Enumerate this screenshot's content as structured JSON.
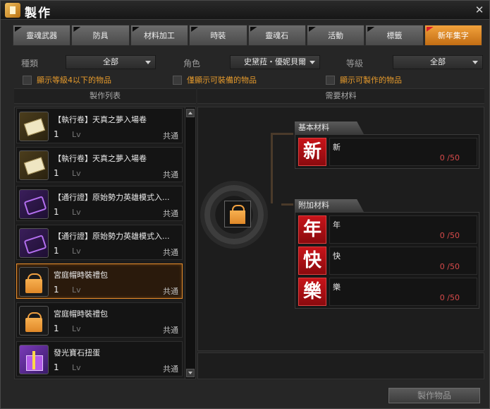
{
  "window": {
    "title": "製作"
  },
  "tabs": [
    {
      "label": "靈魂武器",
      "active": false
    },
    {
      "label": "防具",
      "active": false
    },
    {
      "label": "材料加工",
      "active": false
    },
    {
      "label": "時裝",
      "active": false
    },
    {
      "label": "靈魂石",
      "active": false
    },
    {
      "label": "活動",
      "active": false
    },
    {
      "label": "標籤",
      "active": false
    },
    {
      "label": "新年集字",
      "active": true
    }
  ],
  "filters": {
    "type_label": "種類",
    "type_value": "全部",
    "character_label": "角色",
    "character_value": "史黛菈・優妮貝爾",
    "level_label": "等級",
    "level_value": "全部"
  },
  "checks": {
    "below_level": "顯示等級4以下的物品",
    "equippable_only": "僅顯示可裝備的物品",
    "craftable": "顯示可製作的物品"
  },
  "columns": {
    "list": "製作列表",
    "materials": "需要材料"
  },
  "list_items": [
    {
      "icon": "ticket-icon",
      "name": "【執行卷】天真之夢入場卷",
      "qty": "1",
      "lv": "Lv",
      "job": "共通",
      "selected": false
    },
    {
      "icon": "ticket-icon",
      "name": "【執行卷】天真之夢入場卷",
      "qty": "1",
      "lv": "Lv",
      "job": "共通",
      "selected": false
    },
    {
      "icon": "pass-icon",
      "name": "【通行證】原始勢力英雄模式入...",
      "qty": "1",
      "lv": "Lv",
      "job": "共通",
      "selected": false
    },
    {
      "icon": "pass-icon",
      "name": "【通行證】原始勢力英雄模式入...",
      "qty": "1",
      "lv": "Lv",
      "job": "共通",
      "selected": false
    },
    {
      "icon": "bag-icon",
      "name": "宮庭帽時裝禮包",
      "qty": "1",
      "lv": "Lv",
      "job": "共通",
      "selected": true
    },
    {
      "icon": "bag-icon",
      "name": "宮庭帽時裝禮包",
      "qty": "1",
      "lv": "Lv",
      "job": "共通",
      "selected": false
    },
    {
      "icon": "gift-icon",
      "name": "發光寶石扭蛋",
      "qty": "1",
      "lv": "Lv",
      "job": "共通",
      "selected": false
    }
  ],
  "materials": {
    "basic_label": "基本材料",
    "basic": [
      {
        "glyph": "新",
        "name": "新",
        "count": "0 /50"
      }
    ],
    "extra_label": "附加材料",
    "extra": [
      {
        "glyph": "年",
        "name": "年",
        "count": "0 /50"
      },
      {
        "glyph": "快",
        "name": "快",
        "count": "0 /50"
      },
      {
        "glyph": "樂",
        "name": "樂",
        "count": "0 /50"
      }
    ]
  },
  "craft_button": "製作物品"
}
